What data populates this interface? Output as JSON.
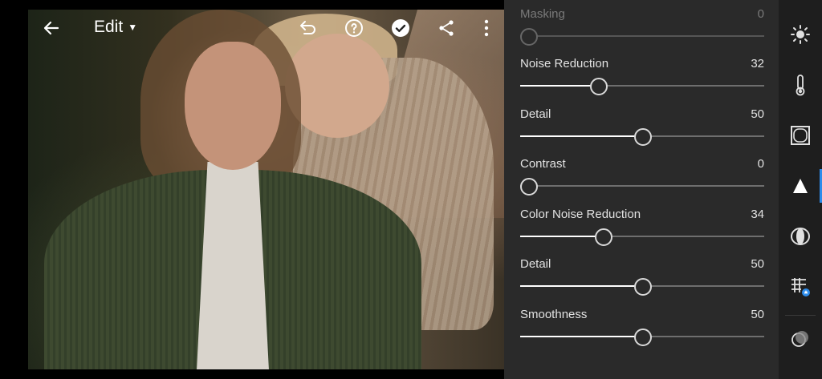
{
  "topbar": {
    "back_icon": "arrow-left-icon",
    "edit_label": "Edit",
    "undo_icon": "undo-icon",
    "help_icon": "help-icon",
    "done_icon": "checkmark-circle-icon",
    "share_icon": "share-icon",
    "more_icon": "more-vertical-icon"
  },
  "photo": {
    "description_icon": "photo-preview"
  },
  "detail_panel": {
    "sliders": [
      {
        "label": "Masking",
        "value": "0",
        "fraction": 0.0,
        "disabled": true
      },
      {
        "label": "Noise Reduction",
        "value": "32",
        "fraction": 0.32,
        "disabled": false
      },
      {
        "label": "Detail",
        "value": "50",
        "fraction": 0.5,
        "disabled": false
      },
      {
        "label": "Contrast",
        "value": "0",
        "fraction": 0.0,
        "disabled": false
      },
      {
        "label": "Color Noise Reduction",
        "value": "34",
        "fraction": 0.34,
        "disabled": false
      },
      {
        "label": "Detail",
        "value": "50",
        "fraction": 0.5,
        "disabled": false
      },
      {
        "label": "Smoothness",
        "value": "50",
        "fraction": 0.5,
        "disabled": false
      }
    ]
  },
  "tool_rail": {
    "tools": [
      {
        "name": "light-icon"
      },
      {
        "name": "color-temperature-icon"
      },
      {
        "name": "effects-icon"
      },
      {
        "name": "detail-icon",
        "active": true
      },
      {
        "name": "optics-icon"
      },
      {
        "name": "geometry-icon"
      },
      {
        "name": "versions-icon"
      }
    ]
  },
  "colors": {
    "accent": "#2d8ceb",
    "panel": "#2a2a2a",
    "rail": "#1e1e1e"
  }
}
